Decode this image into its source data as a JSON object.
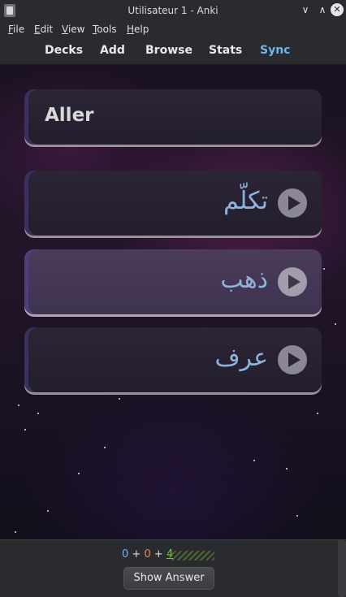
{
  "window": {
    "title": "Utilisateur 1 - Anki",
    "controls": [
      "minimize",
      "maximize",
      "close"
    ]
  },
  "menu": {
    "file": "File",
    "edit": "Edit",
    "view": "View",
    "tools": "Tools",
    "help": "Help"
  },
  "toolbar": {
    "decks": "Decks",
    "add": "Add",
    "browse": "Browse",
    "stats": "Stats",
    "sync": "Sync"
  },
  "card": {
    "title": "Aller",
    "words": [
      {
        "text": "تكلّم"
      },
      {
        "text": "ذهب"
      },
      {
        "text": "عرف"
      }
    ]
  },
  "counts": {
    "new": "0",
    "plus1": "+",
    "learn": "0",
    "plus2": "+",
    "review": "4"
  },
  "actions": {
    "show_answer": "Show Answer"
  },
  "colors": {
    "accent": "#6ab7f0",
    "arabic": "#8fb2dc",
    "learn": "#e8844a",
    "review": "#6fcf3f"
  }
}
